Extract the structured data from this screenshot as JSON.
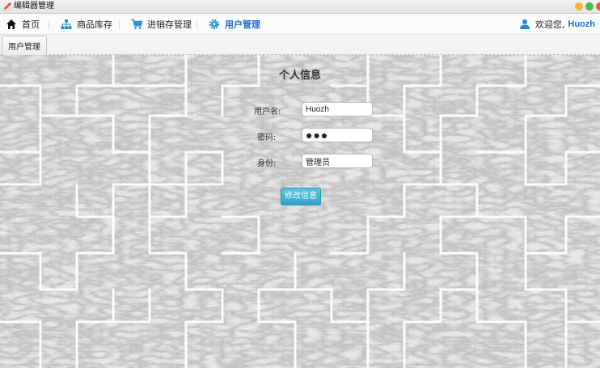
{
  "window": {
    "title": "编辑器管理",
    "icon": "pencil-icon",
    "controls": [
      "minimize-button",
      "maximize-button",
      "close-button"
    ]
  },
  "navbar": {
    "items": [
      {
        "label": "首页",
        "icon": "home-icon"
      },
      {
        "label": "商品库存",
        "icon": "sitemap-icon"
      },
      {
        "label": "进销存管理",
        "icon": "cart-icon"
      },
      {
        "label": "用户管理",
        "icon": "gear-icon",
        "active": true
      }
    ],
    "welcome": "欢迎您,",
    "username": "Huozh",
    "user_icon": "user-icon"
  },
  "tabs": [
    {
      "label": "用户管理"
    }
  ],
  "form": {
    "title": "个人信息",
    "username_label": "用户名:",
    "username_value": "Huozh",
    "password_label": "密码:",
    "password_value": "●●●",
    "role_label": "身份:",
    "role_value": "管理员",
    "submit_label": "修改信息"
  },
  "colors": {
    "accent": "#1d6fd0",
    "button": "#38aed1"
  }
}
